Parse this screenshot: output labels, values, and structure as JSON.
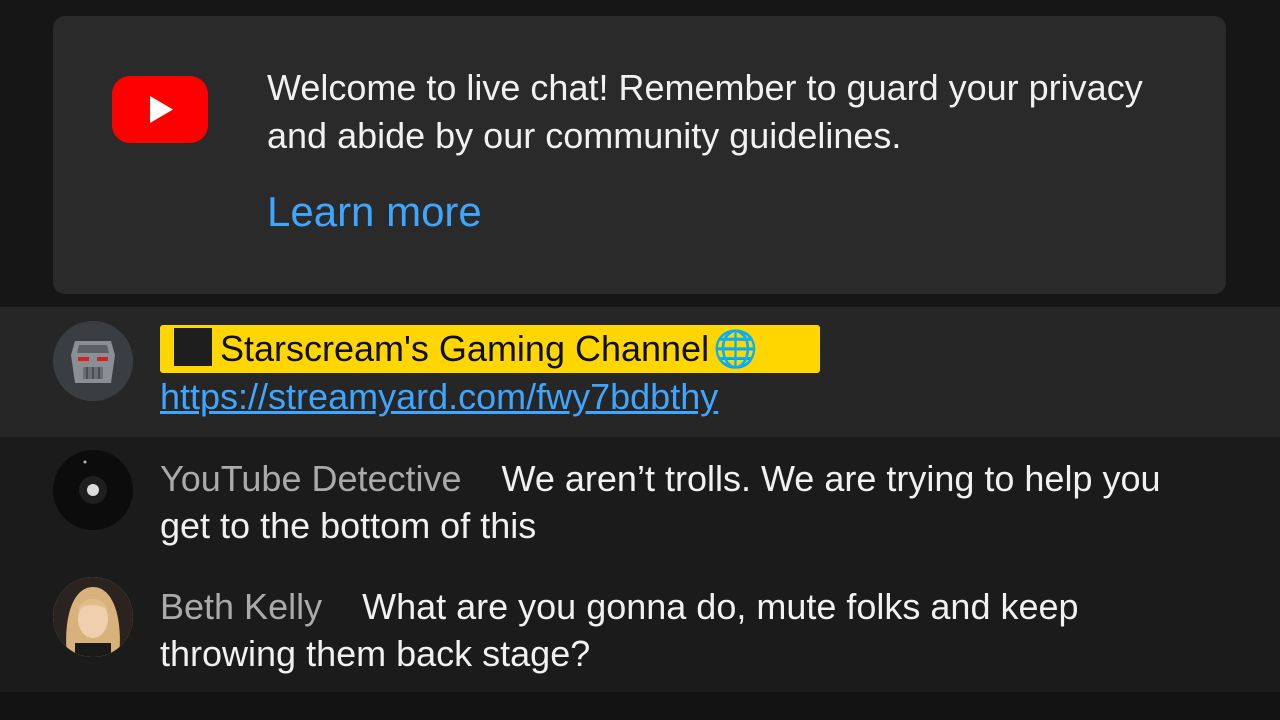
{
  "welcome": {
    "message": "Welcome to live chat! Remember to guard your privacy and abide by our community guidelines.",
    "learn_more": "Learn more",
    "logo_icon": "youtube-logo-icon",
    "accent_color": "#3ea6ff",
    "logo_color": "#ff0000"
  },
  "messages": [
    {
      "author": "Starscream's Gaming Channel",
      "author_role": "owner",
      "badge_color": "#ffd600",
      "globe_icon": "globe-icon",
      "text_link": "https://streamyard.com/fwy7bdbthy"
    },
    {
      "author": "YouTube Detective",
      "text": "We aren’t trolls. We are trying to help you get to the bottom of this"
    },
    {
      "author": "Beth Kelly",
      "text": "What are you gonna do, mute folks and keep throwing them back stage?"
    }
  ]
}
